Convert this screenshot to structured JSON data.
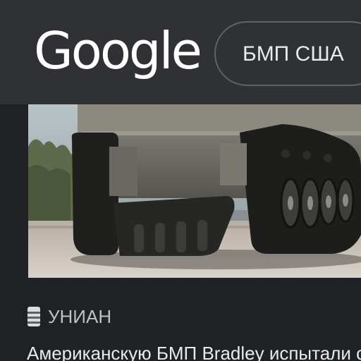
{
  "header": {
    "logo_text": "Google",
    "search_query": "БМП США"
  },
  "result": {
    "source": "УНИАН",
    "source_icon": "news-source-icon",
    "headline": "Американскую БМП Bradley испытали с но"
  },
  "thumbnail": {
    "icon": "tracked-vehicle-photo"
  },
  "colors": {
    "page_background": "#202124",
    "header_background": "#303134",
    "search_border": "#5f6368",
    "text_primary": "#e8eaed",
    "text_secondary": "#bdc1c6"
  }
}
